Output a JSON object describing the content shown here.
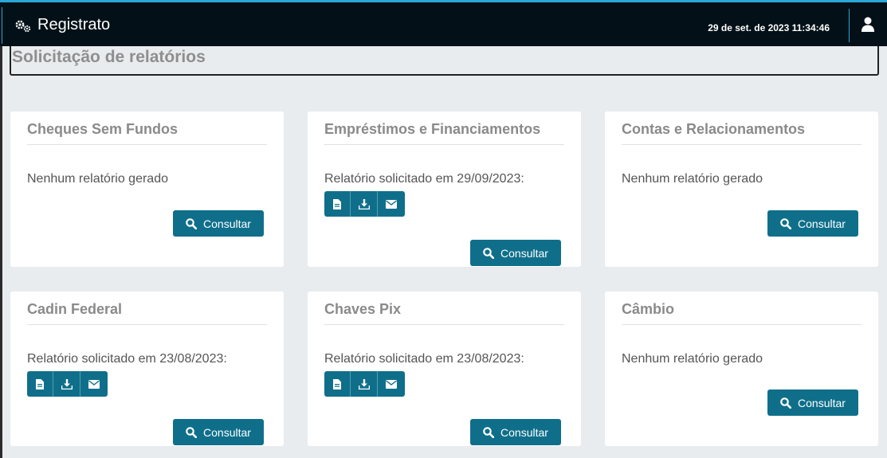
{
  "app": {
    "title": "Registrato",
    "datetime": "29 de set. de 2023 11:34:46"
  },
  "page": {
    "title": "Solicitação de relatórios"
  },
  "colors": {
    "topbar": "#031017",
    "accent_line": "#2aa7d8",
    "button": "#0f6f8a",
    "card": "#ffffff",
    "background": "#e9ecef"
  },
  "cards": [
    {
      "title": "Cheques Sem Fundos",
      "status": "Nenhum relatório gerado",
      "button": "Consultar"
    },
    {
      "title": "Empréstimos e Financiamentos",
      "status": "Relatório solicitado em 29/09/2023:",
      "button": "Consultar"
    },
    {
      "title": "Contas e Relacionamentos",
      "status": "Nenhum relatório gerado",
      "button": "Consultar"
    },
    {
      "title": "Cadin Federal",
      "status": "Relatório solicitado em 23/08/2023:",
      "button": "Consultar"
    },
    {
      "title": "Chaves Pix",
      "status": "Relatório solicitado em 23/08/2023:",
      "button": "Consultar"
    },
    {
      "title": "Câmbio",
      "status": "Nenhum relatório gerado",
      "button": "Consultar"
    }
  ],
  "icons": {
    "brand": "gears-icon",
    "user": "user-icon",
    "view": "file-icon",
    "download": "download-icon",
    "email": "envelope-icon",
    "search": "search-icon"
  }
}
